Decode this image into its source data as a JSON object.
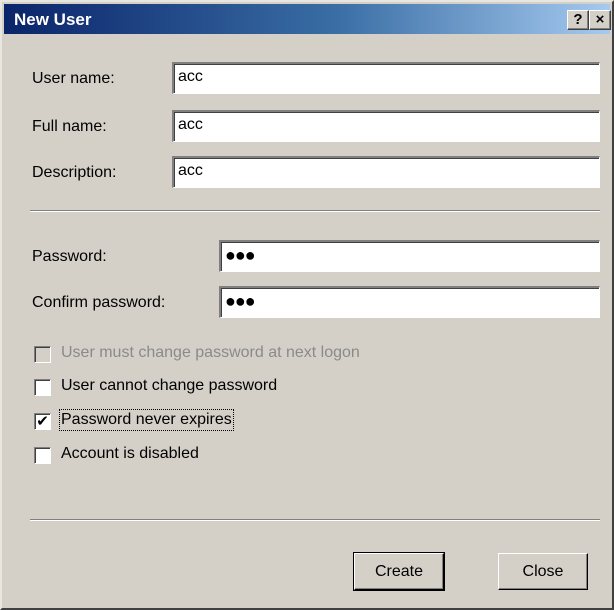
{
  "window": {
    "title": "New User"
  },
  "titlebar": {
    "help": "?",
    "close": "×"
  },
  "form": {
    "user_name": {
      "label": "User name:",
      "value": "acc"
    },
    "full_name": {
      "label": "Full name:",
      "value": "acc"
    },
    "description": {
      "label": "Description:",
      "value": "acc"
    },
    "password": {
      "label": "Password:",
      "value": "●●●"
    },
    "confirm_password": {
      "label": "Confirm password:",
      "value": "●●●"
    }
  },
  "options": [
    {
      "label": "User must change password at next logon",
      "checked": false,
      "enabled": false
    },
    {
      "label": "User cannot change password",
      "checked": false,
      "enabled": true
    },
    {
      "label": "Password never expires",
      "checked": true,
      "enabled": true
    },
    {
      "label": "Account is disabled",
      "checked": false,
      "enabled": true
    }
  ],
  "buttons": {
    "create": "Create",
    "close": "Close"
  }
}
